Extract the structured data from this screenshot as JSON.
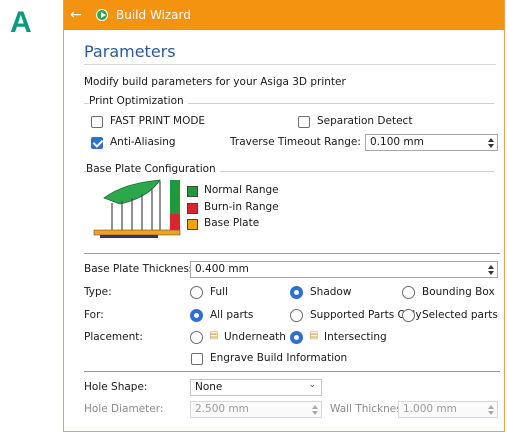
{
  "figure_label": "A",
  "window": {
    "title": "Build Wizard"
  },
  "page": {
    "heading": "Parameters",
    "subtitle": "Modify build parameters for your Asiga 3D printer"
  },
  "print_optimization": {
    "group_label": "Print Optimization",
    "fast_print_mode": {
      "label": "FAST PRINT MODE",
      "checked": false
    },
    "separation_detect": {
      "label": "Separation Detect",
      "checked": false
    },
    "anti_aliasing": {
      "label": "Anti-Aliasing",
      "checked": true
    },
    "traverse_timeout": {
      "label": "Traverse Timeout Range:",
      "value": "0.100 mm"
    }
  },
  "base_plate": {
    "group_label": "Base Plate Configuration",
    "legend": [
      {
        "label": "Normal Range",
        "color": "#1f9a3a"
      },
      {
        "label": "Burn-in Range",
        "color": "#d8262b"
      },
      {
        "label": "Base Plate",
        "color": "#f4a11a"
      }
    ],
    "thickness": {
      "label": "Base Plate Thickness:",
      "value": "0.400 mm"
    },
    "type": {
      "label": "Type:",
      "options": [
        "Full",
        "Shadow",
        "Bounding Box"
      ],
      "selected": "Shadow"
    },
    "for": {
      "label": "For:",
      "options": [
        "All parts",
        "Supported Parts Only",
        "Selected parts"
      ],
      "selected": "All parts"
    },
    "placement": {
      "label": "Placement:",
      "options": [
        "Underneath",
        "Intersecting"
      ],
      "selected": "Intersecting"
    },
    "engrave": {
      "label": "Engrave Build Information",
      "checked": false
    }
  },
  "holes": {
    "shape": {
      "label": "Hole Shape:",
      "value": "None"
    },
    "diameter": {
      "label": "Hole Diameter:",
      "value": "2.500 mm"
    },
    "wall": {
      "label": "Wall Thickness:",
      "value": "1.000 mm"
    }
  },
  "colors": {
    "titlebar": "#f3930f",
    "accent": "#2f6fd0",
    "heading": "#2a5a9a"
  }
}
